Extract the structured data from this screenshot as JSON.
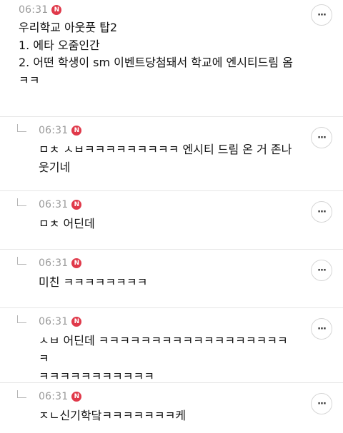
{
  "post": {
    "time": "06:31",
    "badge": "N",
    "lines": [
      "우리학교 아웃풋 탑2",
      "1. 에타 오줌인간",
      "2. 어떤 학생이 sm 이벤트당첨돼서 학교에 엔시티드림 옴",
      "ㅋㅋ"
    ]
  },
  "replies": [
    {
      "time": "06:31",
      "badge": "N",
      "lines": [
        "ㅁㅊ ㅅㅂㅋㅋㅋㅋㅋㅋㅋㅋㅋ 엔시티 드림 온 거 존나",
        "웃기네"
      ]
    },
    {
      "time": "06:31",
      "badge": "N",
      "lines": [
        "ㅁㅊ 어딘데"
      ]
    },
    {
      "time": "06:31",
      "badge": "N",
      "lines": [
        "미친 ㅋㅋㅋㅋㅋㅋㅋㅋ"
      ]
    },
    {
      "time": "06:31",
      "badge": "N",
      "lines": [
        "ㅅㅂ 어딘데 ㅋㅋㅋㅋㅋㅋㅋㅋㅋㅋㅋㅋㅋㅋㅋㅋㅋㅋㅋ",
        "ㅋㅋㅋㅋㅋㅋㅋㅋㅋㅋㅋ"
      ]
    },
    {
      "time": "06:31",
      "badge": "N",
      "lines": [
        "ㅈㄴ신기학닼ㅋㅋㅋㅋㅋㅋㅋ케"
      ]
    }
  ],
  "more_label": "···"
}
